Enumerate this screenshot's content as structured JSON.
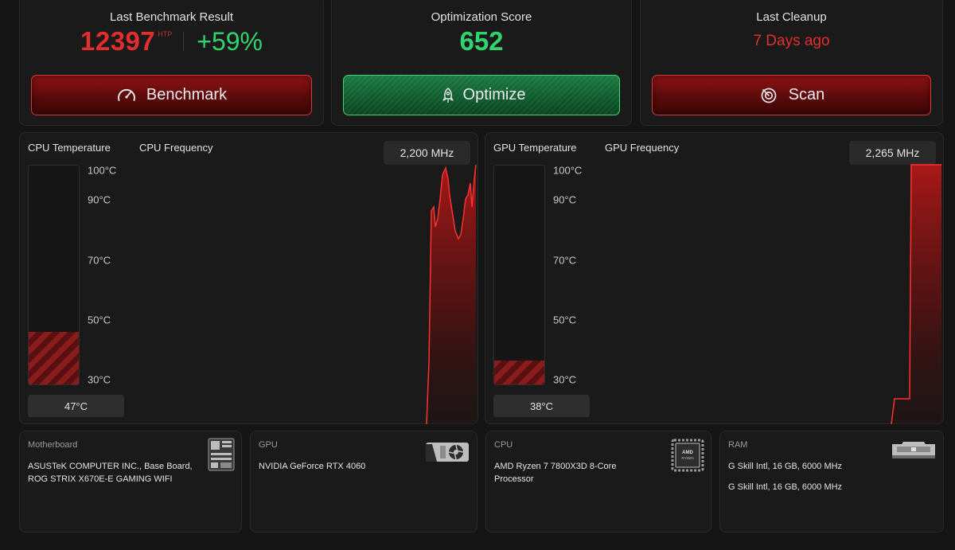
{
  "benchmark": {
    "title": "Last Benchmark Result",
    "score": "12397",
    "score_unit": "HTP",
    "change": "+59%",
    "button_label": "Benchmark",
    "button_icon": "speedometer-icon"
  },
  "optimization": {
    "title": "Optimization Score",
    "score": "652",
    "button_label": "Optimize",
    "button_icon": "rocket-icon"
  },
  "cleanup": {
    "title": "Last Cleanup",
    "value": "7 Days ago",
    "button_label": "Scan",
    "button_icon": "radar-scan-icon"
  },
  "cpu_monitor": {
    "temp_label": "CPU Temperature",
    "freq_label": "CPU Frequency",
    "freq_value": "2,200 MHz",
    "temp_value": "47°C",
    "temp_fill_fraction": 0.24,
    "ticks": [
      "100°C",
      "90°C",
      "70°C",
      "50°C",
      "30°C"
    ]
  },
  "gpu_monitor": {
    "temp_label": "GPU Temperature",
    "freq_label": "GPU Frequency",
    "freq_value": "2,265 MHz",
    "temp_value": "38°C",
    "temp_fill_fraction": 0.11,
    "ticks": [
      "100°C",
      "90°C",
      "70°C",
      "50°C",
      "30°C"
    ]
  },
  "hardware": {
    "motherboard": {
      "title": "Motherboard",
      "line1": "ASUSTeK COMPUTER INC., Base Board,",
      "line2": "ROG STRIX X670E-E GAMING WIFI",
      "icon": "motherboard-icon"
    },
    "gpu": {
      "title": "GPU",
      "line1": "NVIDIA GeForce RTX 4060",
      "icon": "graphics-card-icon"
    },
    "cpu": {
      "title": "CPU",
      "line1": "AMD Ryzen 7 7800X3D 8-Core",
      "line2": "Processor",
      "icon": "processor-chip-icon",
      "icon_text": "AMD RYZEN"
    },
    "ram": {
      "title": "RAM",
      "line1": "G Skill Intl, 16 GB, 6000 MHz",
      "line2": "G Skill Intl, 16 GB, 6000 MHz",
      "icon": "ram-stick-icon"
    }
  },
  "colors": {
    "accent_red": "#e42d2d",
    "accent_green": "#2fd46e",
    "background": "#151515",
    "card": "#1a1a1a"
  }
}
